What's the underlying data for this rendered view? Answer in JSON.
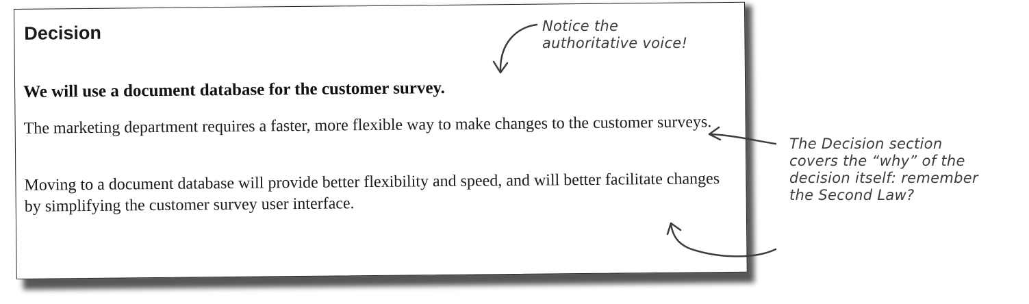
{
  "document": {
    "section_title": "Decision",
    "decision_statement": "We will use a document database for the customer survey.",
    "paragraphs": [
      "The marketing department requires a faster, more flexible way to make changes to the customer surveys.",
      "Moving to a document database will provide better flexibility and speed, and will better facilitate changes by simplifying the customer survey user interface."
    ]
  },
  "annotations": {
    "voice_note": "Notice the\nauthoritative voice!",
    "decision_note": "The Decision section\ncovers the “why” of the\ndecision itself: remember\nthe Second Law?"
  },
  "colors": {
    "ink": "#3c3c3c",
    "border": "#222222",
    "paper": "#ffffff"
  }
}
